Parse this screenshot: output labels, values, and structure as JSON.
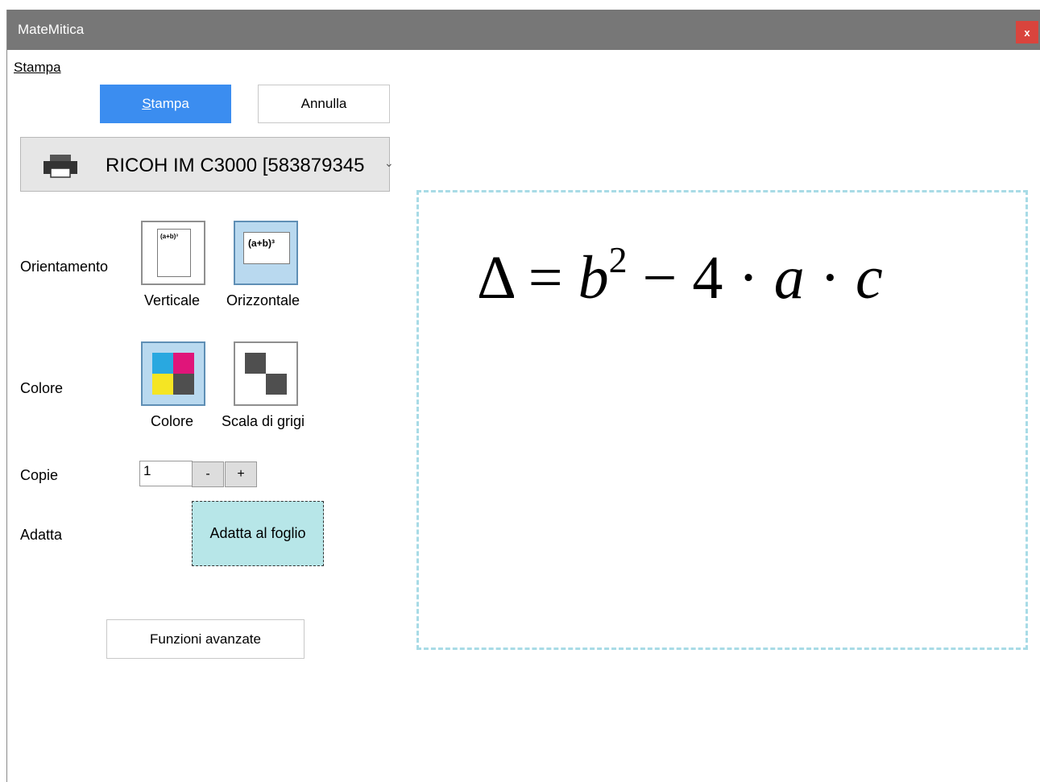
{
  "window": {
    "title": "MateMitica",
    "close_label": "x"
  },
  "menu": {
    "stampa_label": "Stampa"
  },
  "buttons": {
    "print_label": "Stampa",
    "cancel_label": "Annulla"
  },
  "printer": {
    "name": "RICOH IM C3000 [583879345",
    "icon": "printer-icon",
    "dropdown_icon": "chevron-down-icon"
  },
  "orientation": {
    "label": "Orientamento",
    "vertical_caption": "Verticale",
    "horizontal_caption": "Orizzontale",
    "preview_text": "(a+b)³",
    "selected": "Orizzontale"
  },
  "color": {
    "label": "Colore",
    "color_caption": "Colore",
    "grayscale_caption": "Scala di grigi",
    "selected": "Colore"
  },
  "copies": {
    "label": "Copie",
    "value": "1",
    "minus_label": "-",
    "plus_label": "+"
  },
  "fit": {
    "label": "Adatta",
    "button_label": "Adatta al foglio"
  },
  "advanced": {
    "button_label": "Funzioni avanzate"
  },
  "preview": {
    "delta": "Δ",
    "equals": " = ",
    "b": "b",
    "exponent": "2",
    "minus_four": " − 4 · ",
    "a": "a",
    "dot": " · ",
    "c": "c"
  },
  "colors": {
    "titlebar": "#777777",
    "close": "#d9443d",
    "primary": "#3b8df0",
    "selected_option": "#b9d9ef",
    "fit_button": "#b7e6e8",
    "preview_border": "#a8dbe6",
    "cyan": "#29a8e0",
    "magenta": "#e0157a",
    "yellow": "#f5e523",
    "black": "#4f4f4f"
  }
}
